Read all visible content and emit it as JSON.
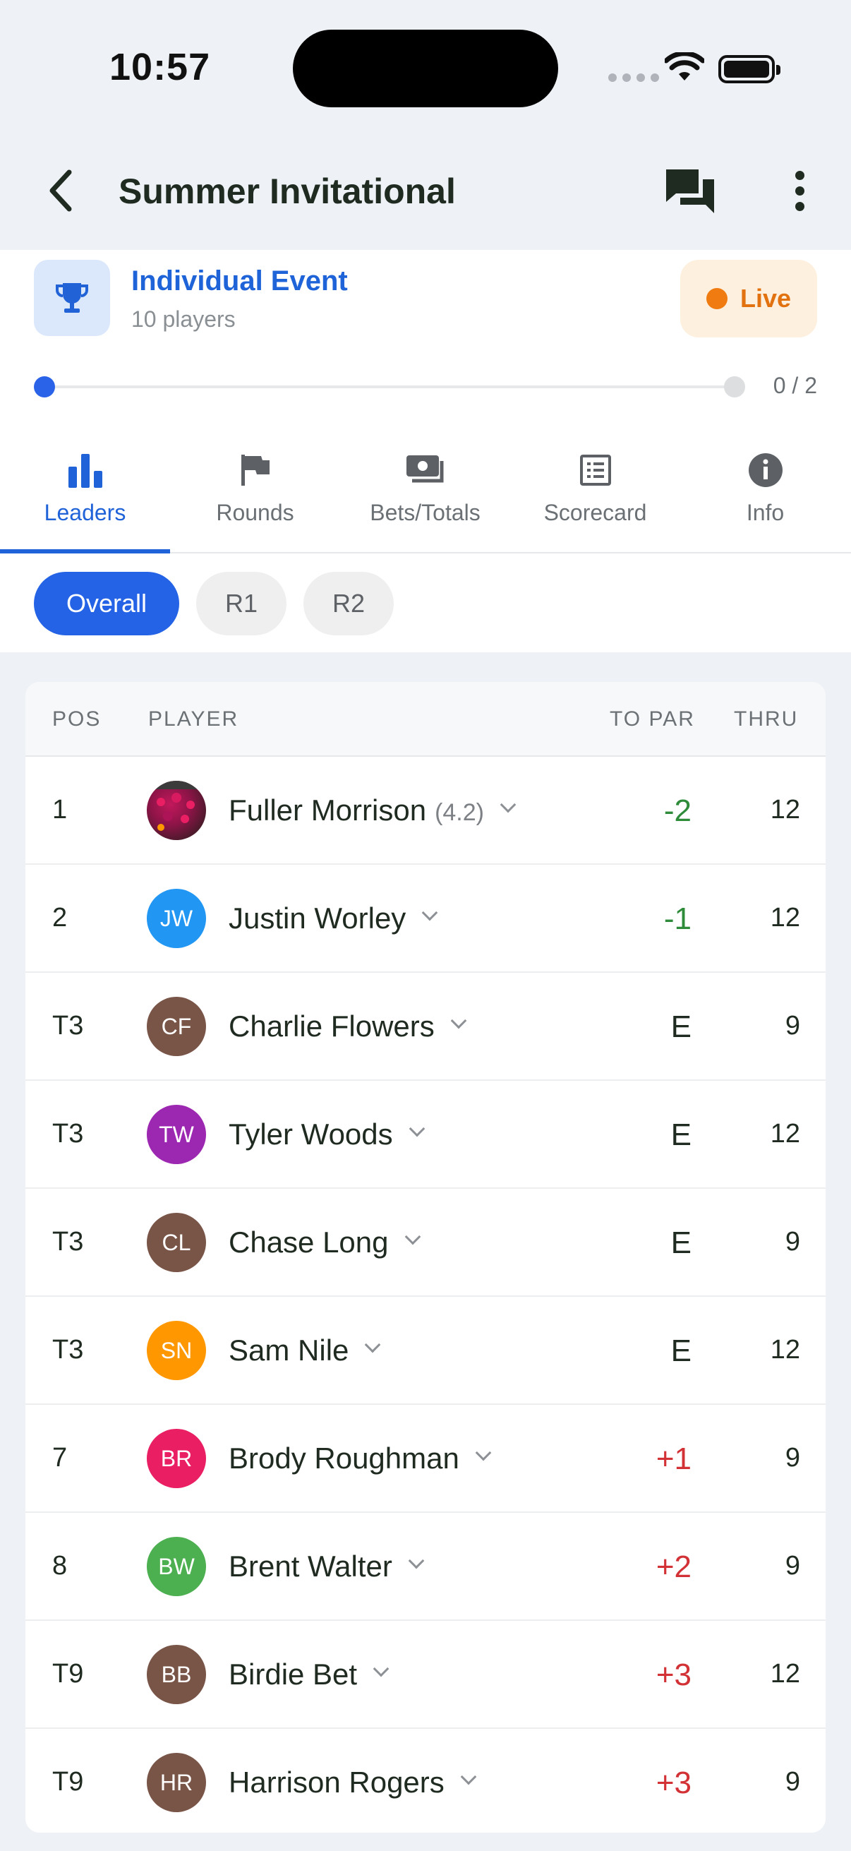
{
  "status_bar": {
    "time": "10:57"
  },
  "header": {
    "title": "Summer Invitational"
  },
  "event": {
    "title": "Individual Event",
    "subtitle": "10 players",
    "badge": "Live",
    "progress_text": "0 / 2",
    "progress_value": 0
  },
  "tabs": [
    {
      "label": "Leaders",
      "icon": "bar-chart-icon",
      "active": true
    },
    {
      "label": "Rounds",
      "icon": "flag-icon",
      "active": false
    },
    {
      "label": "Bets/Totals",
      "icon": "money-icon",
      "active": false
    },
    {
      "label": "Scorecard",
      "icon": "scorecard-icon",
      "active": false
    },
    {
      "label": "Info",
      "icon": "info-icon",
      "active": false
    }
  ],
  "chips": [
    {
      "label": "Overall",
      "active": true
    },
    {
      "label": "R1",
      "active": false
    },
    {
      "label": "R2",
      "active": false
    }
  ],
  "table": {
    "headers": {
      "pos": "POS",
      "player": "PLAYER",
      "to_par": "TO PAR",
      "thru": "THRU"
    },
    "rows": [
      {
        "pos": "1",
        "name": "Fuller Morrison",
        "handicap": "(4.2)",
        "initials": "",
        "avatar_color": "#7a1a3a",
        "to_par": "-2",
        "thru": "12",
        "status": "under"
      },
      {
        "pos": "2",
        "name": "Justin Worley",
        "handicap": "",
        "initials": "JW",
        "avatar_color": "#2196f3",
        "to_par": "-1",
        "thru": "12",
        "status": "under"
      },
      {
        "pos": "T3",
        "name": "Charlie Flowers",
        "handicap": "",
        "initials": "CF",
        "avatar_color": "#795548",
        "to_par": "E",
        "thru": "9",
        "status": "even"
      },
      {
        "pos": "T3",
        "name": "Tyler Woods",
        "handicap": "",
        "initials": "TW",
        "avatar_color": "#9c27b0",
        "to_par": "E",
        "thru": "12",
        "status": "even"
      },
      {
        "pos": "T3",
        "name": "Chase Long",
        "handicap": "",
        "initials": "CL",
        "avatar_color": "#795548",
        "to_par": "E",
        "thru": "9",
        "status": "even"
      },
      {
        "pos": "T3",
        "name": "Sam Nile",
        "handicap": "",
        "initials": "SN",
        "avatar_color": "#ff9800",
        "to_par": "E",
        "thru": "12",
        "status": "even"
      },
      {
        "pos": "7",
        "name": "Brody Roughman",
        "handicap": "",
        "initials": "BR",
        "avatar_color": "#e91e63",
        "to_par": "+1",
        "thru": "9",
        "status": "over"
      },
      {
        "pos": "8",
        "name": "Brent Walter",
        "handicap": "",
        "initials": "BW",
        "avatar_color": "#4caf50",
        "to_par": "+2",
        "thru": "9",
        "status": "over"
      },
      {
        "pos": "T9",
        "name": "Birdie Bet",
        "handicap": "",
        "initials": "BB",
        "avatar_color": "#795548",
        "to_par": "+3",
        "thru": "12",
        "status": "over"
      },
      {
        "pos": "T9",
        "name": "Harrison Rogers",
        "handicap": "",
        "initials": "HR",
        "avatar_color": "#795548",
        "to_par": "+3",
        "thru": "9",
        "status": "over"
      }
    ]
  },
  "colors": {
    "accent": "#2463e6",
    "live": "#f07b10",
    "under_par": "#2e8b3a",
    "over_par": "#d23235"
  }
}
